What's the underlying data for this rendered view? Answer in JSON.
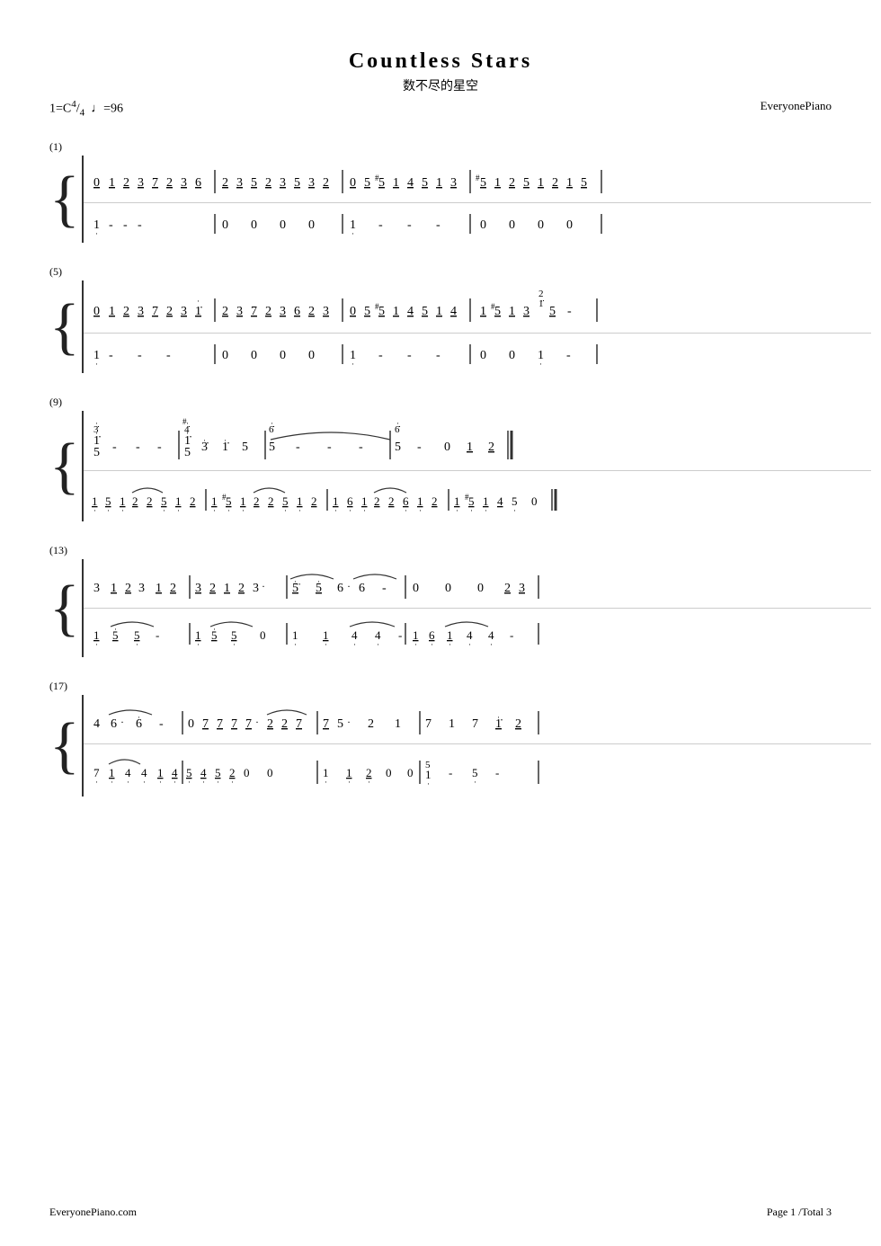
{
  "page": {
    "title_en": "Countless Stars",
    "title_cn": "数不尽的星空",
    "key": "1=C",
    "time": "4/4",
    "tempo": "♩=96",
    "publisher": "EveryonePiano",
    "footer_left": "EveryonePiano.com",
    "footer_right": "Page 1 /Total 3"
  },
  "sections": [
    {
      "label": "(1)"
    },
    {
      "label": "(5)"
    },
    {
      "label": "(9)"
    },
    {
      "label": "(13)"
    },
    {
      "label": "(17)"
    }
  ]
}
